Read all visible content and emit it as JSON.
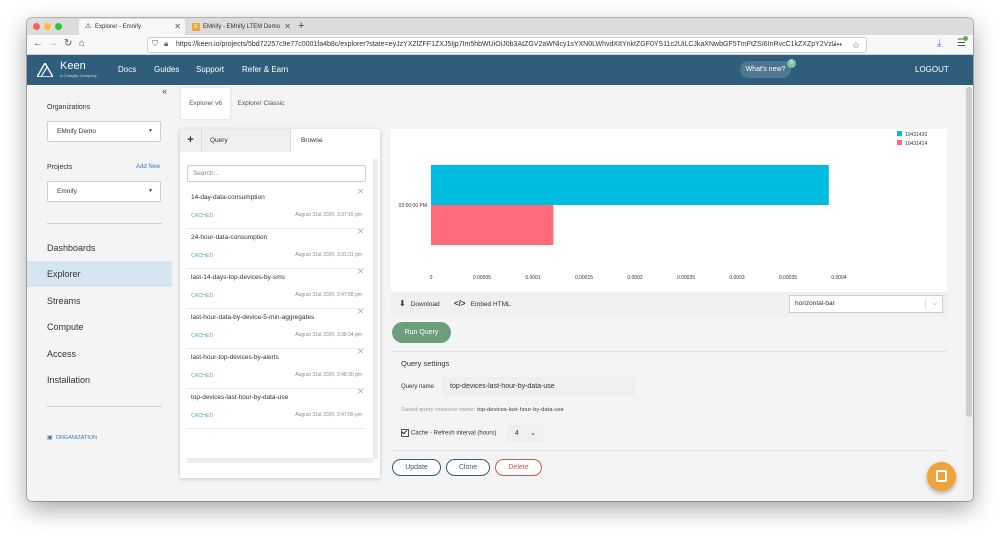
{
  "browser": {
    "tabs": [
      {
        "title": "Explorer - Emnify",
        "active": true
      },
      {
        "title": "EMnify - EMnify LTEM Demo",
        "active": false
      }
    ],
    "url": "https://keen.io/projects/5bd72257c9e77c0001fa4b8c/explorer?state=eyJzYXZlZFF1ZXJ5Ijp7Im5hbWUiOiJ0b3AtZGV2aWNlcy1sYXN0LWhvdXItYnktZGF0YS11c2UiLCJkaXNwbGF5TmFtZSI6InRvcC1kZXZpY2VzLWxh"
  },
  "header": {
    "brand": "Keen",
    "brand_sub": "A Chargify Company",
    "nav": [
      "Docs",
      "Guides",
      "Support",
      "Refer & Earn"
    ],
    "whats_new": "What's new?",
    "whats_new_count": "5",
    "logout": "LOGOUT"
  },
  "sidebar": {
    "organizations_label": "Organizations",
    "organization_value": "EMnify Demo",
    "projects_label": "Projects",
    "add_new": "Add New",
    "project_value": "Emnify",
    "nav": [
      {
        "label": "Dashboards",
        "active": false
      },
      {
        "label": "Explorer",
        "active": true
      },
      {
        "label": "Streams",
        "active": false
      },
      {
        "label": "Compute",
        "active": false
      },
      {
        "label": "Access",
        "active": false
      },
      {
        "label": "Installation",
        "active": false
      }
    ],
    "organization_link": "ORGANIZATION"
  },
  "explorer_tabs": [
    "Explorer v6",
    "Explorer Classic"
  ],
  "panel": {
    "plus": "+",
    "tab_query": "Query",
    "tab_browse": "Browse",
    "search_placeholder": "Search...",
    "queries": [
      {
        "name": "14-day-data-consumption",
        "status": "CACHED",
        "date": "August 31st 2020, 3:37:15 pm"
      },
      {
        "name": "24-hour-data-consumption",
        "status": "CACHED",
        "date": "August 31st 2020, 3:31:31 pm"
      },
      {
        "name": "last-14-days-top-devices-by-sms",
        "status": "CACHED",
        "date": "August 31st 2020, 3:47:58 pm"
      },
      {
        "name": "last-hour-data-by-device-5-min-aggregates",
        "status": "CACHED",
        "date": "August 31st 2020, 3:38:34 pm"
      },
      {
        "name": "last-hour-top-devices-by-alerts",
        "status": "CACHED",
        "date": "August 31st 2020, 3:48:30 pm"
      },
      {
        "name": "top-devices-last-hour-by-data-use",
        "status": "CACHED",
        "date": "August 31st 2020, 3:47:09 pm"
      }
    ]
  },
  "chart_data": {
    "type": "bar",
    "orientation": "horizontal",
    "categories": [
      "03:00:00 PM"
    ],
    "series": [
      {
        "name": "10431420",
        "values": [
          0.00039
        ],
        "color": "#00bde0"
      },
      {
        "name": "10431414",
        "values": [
          0.00012
        ],
        "color": "#ff6b78"
      }
    ],
    "xticks": [
      "0",
      "0.00005",
      "0.0001",
      "0.00015",
      "0.0002",
      "0.00025",
      "0.0003",
      "0.00035",
      "0.0004"
    ],
    "xlim": [
      0,
      0.0004
    ],
    "legend": "top-right",
    "grid": false
  },
  "toolbar": {
    "download": "Download",
    "embed": "Embed HTML",
    "viz_type": "horizontal-bar"
  },
  "run_query": "Run Query",
  "settings": {
    "title": "Query settings",
    "query_name_label": "Query name",
    "query_name_value": "top-devices-last-hour-by-data-use",
    "resource_label": "Saved query resource name:",
    "resource_value": "top-devices-last-hour-by-data-use",
    "cache_label": "Cache",
    "refresh_label": "- Refresh interval (hours)",
    "refresh_value": "4"
  },
  "actions": {
    "update": "Update",
    "clone": "Clone",
    "delete": "Delete"
  },
  "colors": {
    "header": "#2f5e7c",
    "active_nav": "#d6e6f1",
    "run_query": "#6b9e7a",
    "update": "#2f5e7c",
    "delete": "#d9534f",
    "chat": "#f0a33a"
  }
}
